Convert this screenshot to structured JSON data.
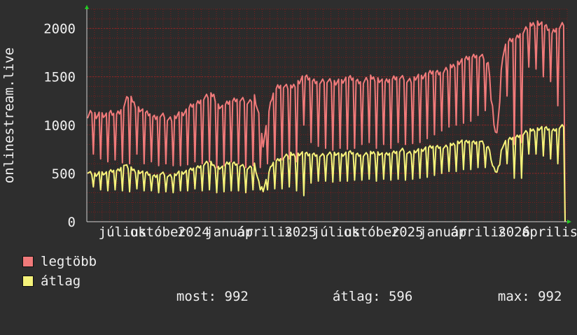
{
  "chart_data": {
    "type": "line",
    "ylabel": "onlinestream.live",
    "ylim": [
      0,
      2200
    ],
    "yticks": [
      0,
      500,
      1000,
      1500,
      2000
    ],
    "x_tick_labels": [
      "július",
      "október",
      "2024",
      "január",
      "április",
      "2025",
      "július",
      "október",
      "2025",
      "január",
      "április",
      "2026",
      "április"
    ],
    "grid": true,
    "colors": {
      "background": "#2e2e2e",
      "plot_bg": "#2b2b2b",
      "grid": "#7a1f1f",
      "axis": "#d0d0d0",
      "text": "#f0f0f0"
    },
    "series": [
      {
        "name": "legtöbb",
        "color": "#f07a7a",
        "values": [
          1100,
          1150,
          1080,
          1120,
          1100,
          1130,
          1110,
          1140,
          1200,
          1300,
          1250,
          1180,
          1150,
          1120,
          1100,
          1080,
          1100,
          1090,
          1070,
          1060,
          1100,
          1120,
          1150,
          1200,
          1220,
          1260,
          1290,
          1300,
          1310,
          1200,
          1180,
          1220,
          1250,
          1270,
          1260,
          1250,
          1240,
          1300,
          1100,
          800,
          1080,
          1300,
          1400,
          1420,
          1400,
          1380,
          1420,
          1450,
          1500,
          1480,
          1460,
          1450,
          1440,
          1470,
          1460,
          1430,
          1450,
          1470,
          1490,
          1480,
          1460,
          1450,
          1470,
          1490,
          1480,
          1460,
          1440,
          1460,
          1490,
          1500,
          1480,
          1470,
          1460,
          1490,
          1500,
          1520,
          1540,
          1560,
          1550,
          1560,
          1580,
          1610,
          1640,
          1660,
          1680,
          1700,
          1720,
          1720,
          1690,
          1650,
          1000,
          900,
          1700,
          1850,
          1880,
          1900,
          1950,
          1980,
          2020,
          2050,
          2060,
          2040,
          2000,
          1950,
          2000,
          2020,
          2050
        ],
        "dips": [
          700,
          650,
          620,
          640,
          610,
          600,
          700,
          600,
          620,
          580,
          600,
          580,
          580,
          590,
          620,
          600,
          620,
          560,
          580,
          620,
          600,
          560,
          580,
          560,
          600,
          640,
          640,
          650,
          620,
          1000,
          820,
          780,
          760,
          740,
          760,
          750,
          760,
          800,
          820,
          760,
          800,
          760,
          820,
          800,
          810,
          820,
          860,
          900,
          940,
          980,
          1000,
          1020,
          1040,
          1100,
          1150,
          1200,
          1240,
          1300,
          800,
          820,
          1600,
          1580,
          1500,
          1450,
          1200,
          0,
          1200
        ]
      },
      {
        "name": "átlag",
        "color": "#f5f27a",
        "values": [
          520,
          500,
          480,
          510,
          500,
          520,
          530,
          540,
          600,
          560,
          540,
          520,
          510,
          500,
          480,
          470,
          500,
          490,
          480,
          470,
          500,
          510,
          520,
          540,
          560,
          580,
          600,
          620,
          580,
          560,
          560,
          600,
          610,
          600,
          580,
          560,
          560,
          600,
          400,
          330,
          480,
          600,
          640,
          660,
          680,
          700,
          690,
          700,
          710,
          690,
          700,
          690,
          680,
          700,
          710,
          700,
          690,
          700,
          720,
          710,
          700,
          690,
          700,
          710,
          720,
          700,
          690,
          700,
          720,
          730,
          740,
          720,
          710,
          730,
          740,
          760,
          770,
          780,
          780,
          770,
          780,
          800,
          820,
          830,
          820,
          830,
          820,
          840,
          800,
          780,
          560,
          500,
          780,
          840,
          860,
          880,
          900,
          920,
          940,
          950,
          960,
          970,
          960,
          940,
          960,
          980,
          990
        ],
        "dips": [
          360,
          330,
          320,
          330,
          320,
          310,
          340,
          320,
          320,
          300,
          310,
          300,
          320,
          320,
          340,
          320,
          330,
          300,
          310,
          320,
          320,
          300,
          330,
          330,
          330,
          340,
          340,
          360,
          320,
          270,
          400,
          420,
          420,
          410,
          420,
          420,
          430,
          430,
          440,
          420,
          440,
          430,
          440,
          430,
          440,
          450,
          460,
          480,
          500,
          520,
          520,
          540,
          540,
          560,
          560,
          580,
          590,
          600,
          450,
          450,
          700,
          700,
          680,
          650,
          600,
          0,
          600
        ]
      }
    ],
    "stats": {
      "most_label": "most:",
      "most": "992",
      "avg_label": "átlag:",
      "avg": "596",
      "max_label": "max:",
      "max": "992"
    }
  }
}
